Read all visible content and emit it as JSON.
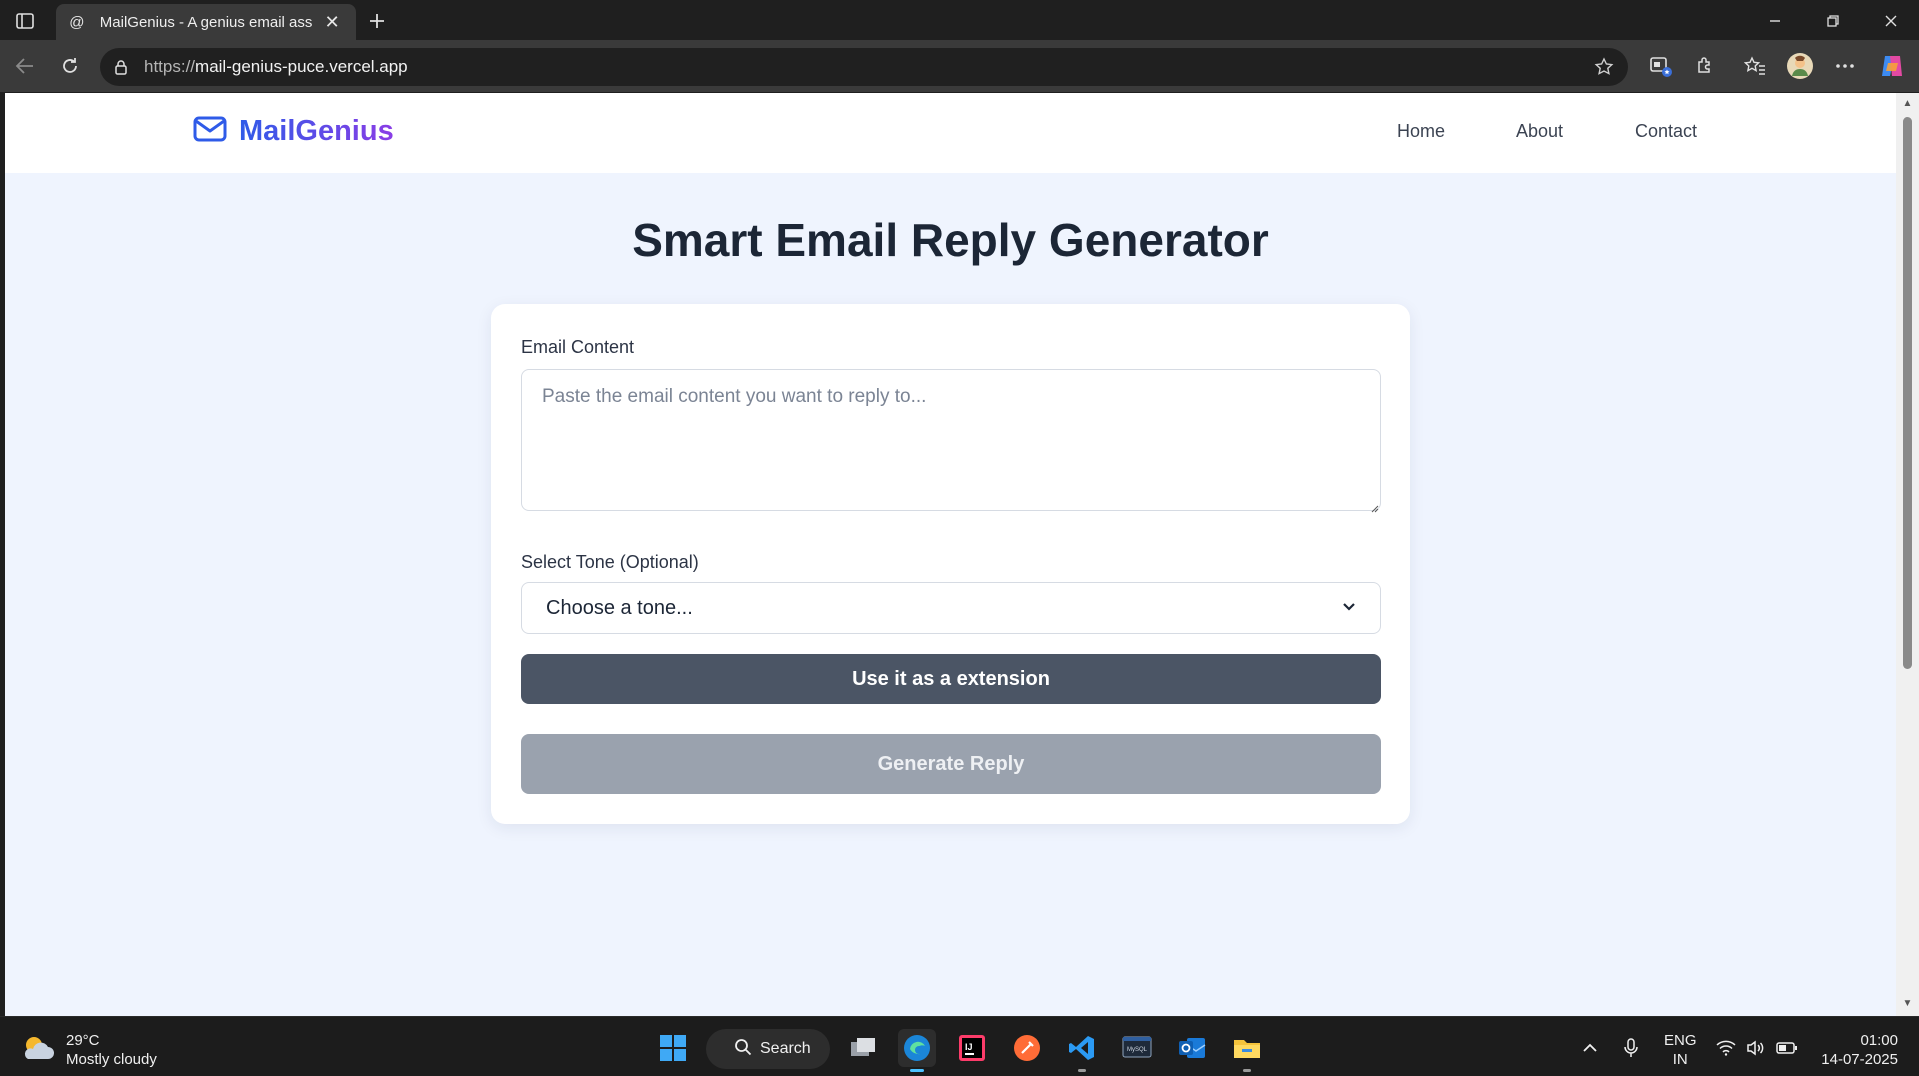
{
  "browser": {
    "tab_title": "MailGenius - A genius email assist",
    "url_protocol": "https://",
    "url_host": "mail-genius-puce.vercel.app"
  },
  "site": {
    "brand": "MailGenius",
    "nav": [
      {
        "label": "Home"
      },
      {
        "label": "About"
      },
      {
        "label": "Contact"
      }
    ]
  },
  "main": {
    "title": "Smart Email Reply Generator",
    "email_label": "Email Content",
    "email_placeholder": "Paste the email content you want to reply to...",
    "email_value": "",
    "tone_label": "Select Tone (Optional)",
    "tone_selected": "Choose a tone...",
    "extension_button": "Use it as a extension",
    "generate_button": "Generate Reply"
  },
  "taskbar": {
    "weather_temp": "29°C",
    "weather_desc": "Mostly cloudy",
    "search_label": "Search",
    "lang_top": "ENG",
    "lang_bottom": "IN",
    "time": "01:00",
    "date": "14-07-2025"
  },
  "colors": {
    "brand_gradient_start": "#2f5be8",
    "brand_gradient_end": "#8a3de6",
    "page_background": "#eff4fe",
    "extension_button_bg": "#4b5565",
    "generate_button_bg": "#9aa2ae"
  },
  "icons": {
    "brand": "mail-icon",
    "tray": [
      "chevron-up-icon",
      "microphone-icon",
      "wifi-icon",
      "speaker-icon",
      "battery-icon"
    ]
  }
}
